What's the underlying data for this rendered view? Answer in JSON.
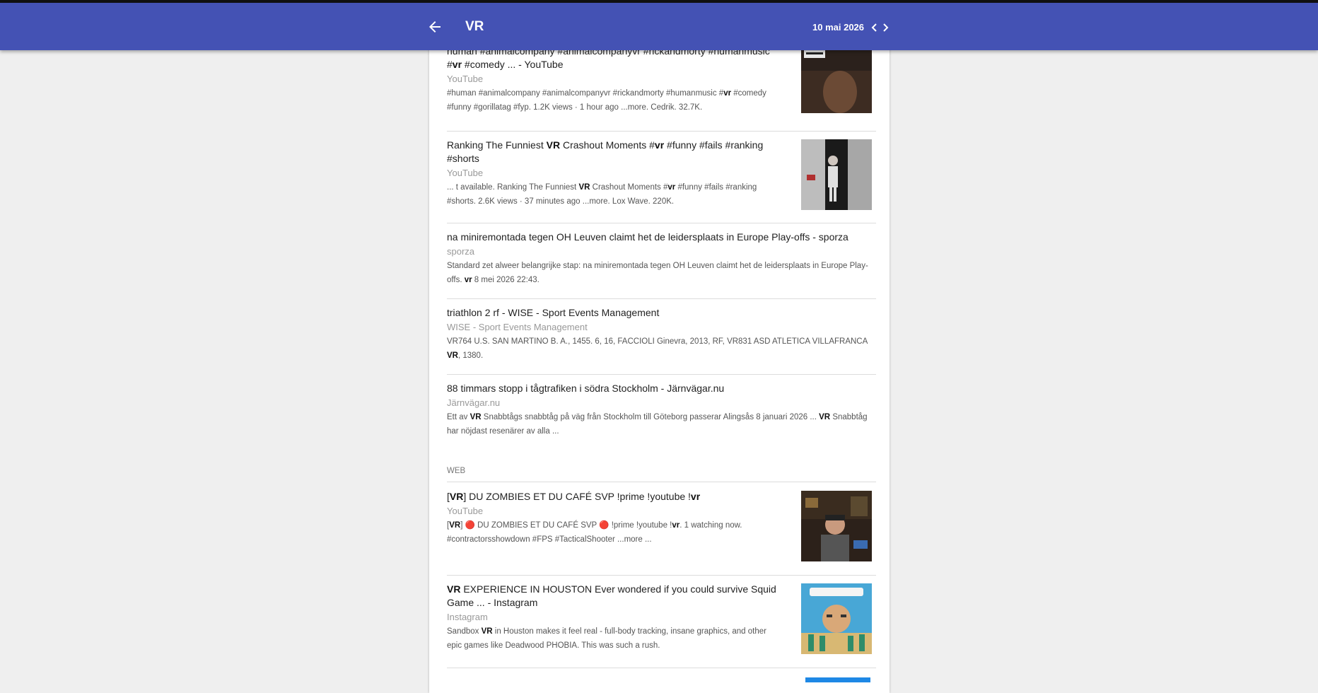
{
  "appbar": {
    "title": "VR",
    "date": "10 mai 2026",
    "icons": {
      "back": "arrow-left-icon",
      "prev": "chevron-left-icon",
      "next": "chevron-right-icon"
    }
  },
  "colors": {
    "appbar": "#4452b4",
    "background": "#efefef",
    "card": "#ffffff"
  },
  "results": [
    {
      "title": "human #animalcompany #animalcompanyvr #rickandmorty #humanmusic #<b>vr</b> #comedy ... - YouTube",
      "source": "YouTube",
      "snippet": "#human #animalcompany #animalcompanyvr #rickandmorty #humanmusic #<b>vr</b> #comedy #funny #gorillatag #fyp. 1.2K views · 1 hour ago ...more. Cedrik. 32.7K.",
      "thumbnail": "human-company-video-thumbnail"
    },
    {
      "title": "Ranking The Funniest <b>VR</b> Crashout Moments #<b>vr</b> #funny #fails #ranking #shorts",
      "source": "YouTube",
      "snippet": "... t available. Ranking The Funniest <b>VR</b> Crashout Moments #<b>vr</b> #funny #fails #ranking #shorts. 2.6K views · 37 minutes ago ...more. Lox Wave. 220K.",
      "thumbnail": "vr-crashout-video-thumbnail"
    },
    {
      "title": "na miniremontada tegen OH Leuven claimt het de leidersplaats in Europe Play-offs - sporza",
      "source": "sporza",
      "snippet": "Standard zet alweer belangrijke stap: na miniremontada tegen OH Leuven claimt het de leidersplaats in Europe Play-offs. <b>vr</b> 8 mei 2026 22:43."
    },
    {
      "title": "triathlon 2 rf - WISE - Sport Events Management",
      "source": "WISE - Sport Events Management",
      "snippet": "VR764 U.S. SAN MARTINO B. A., 1455. 6, 16, FACCIOLI Ginevra, 2013, RF, VR831 ASD ATLETICA VILLAFRANCA <b>VR</b>, 1380."
    },
    {
      "title": "88 timmars stopp i tågtrafiken i södra Stockholm - Järnvägar.nu",
      "source": "Järnvägar.nu",
      "snippet": "Ett av <b>VR</b> Snabbtågs snabbtåg på väg från Stockholm till Göteborg passerar Alingsås 8 januari 2026 ... <b>VR</b> Snabbtåg har nöjdast resenärer av alla ..."
    }
  ],
  "web_section_label": "WEB",
  "web_results": [
    {
      "title": "[<b>VR</b>] DU ZOMBIES ET DU CAFÉ SVP !prime !youtube !<b>vr</b>",
      "source": "YouTube",
      "snippet": "[<b>VR</b>] 🔴 DU ZOMBIES ET DU CAFÉ SVP 🔴 !prime !youtube !<b>vr</b>. 1 watching now. #contractorsshowdown #FPS #TacticalShooter ...more ...",
      "thumbnail": "streamer-webcam-thumbnail"
    },
    {
      "title": "<b>VR</b> EXPERIENCE IN HOUSTON Ever wondered if you could survive Squid Game ... - Instagram",
      "source": "Instagram",
      "snippet": "Sandbox <b>VR</b> in Houston makes it feel real - full-body tracking, insane graphics, and other epic games like Deadwood PHOBIA. This was such a rush.",
      "thumbnail": "squid-game-vr-thumbnail"
    }
  ]
}
